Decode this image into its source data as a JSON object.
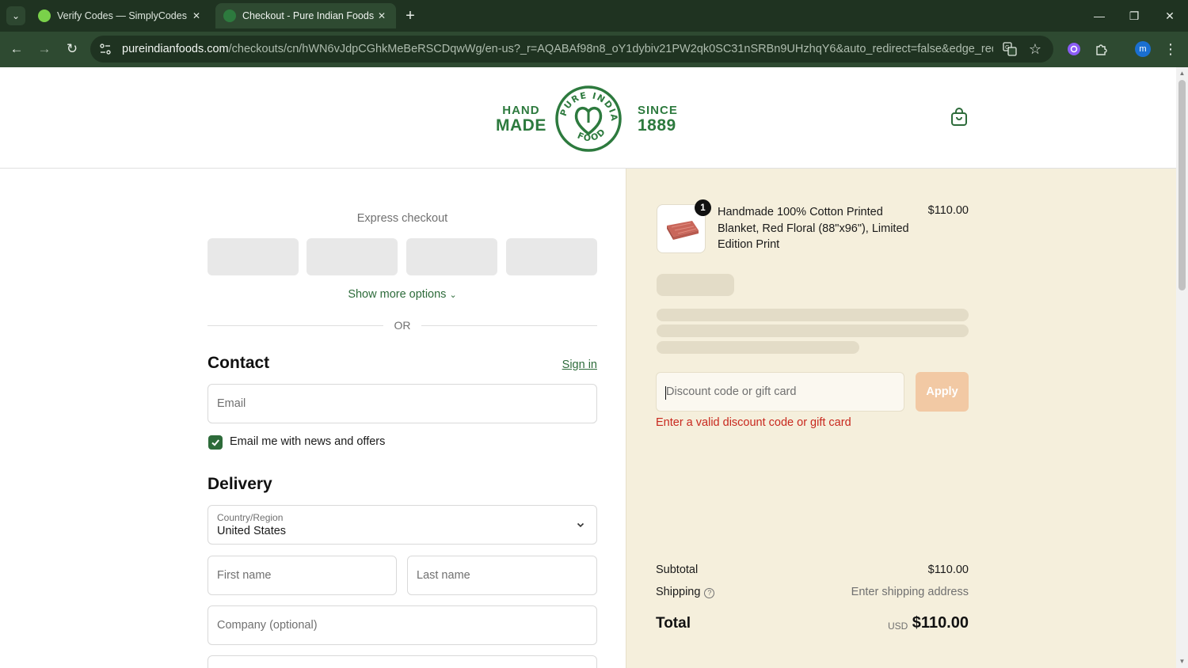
{
  "browser": {
    "tabs": [
      {
        "title": "Verify Codes — SimplyCodes",
        "active": false,
        "favicon_color": "#7ad14a"
      },
      {
        "title": "Checkout - Pure Indian Foods",
        "active": true,
        "favicon_color": "#2d7a3e"
      }
    ],
    "url_host": "pureindianfoods.com",
    "url_path": "/checkouts/cn/hWN6vJdpCGhkMeBeRSCDqwWg/en-us?_r=AQABAf98n8_oY1dybiv21PW2qk0SC31nSRBn9UHzhqY6&auto_redirect=false&edge_redirect=true&...",
    "profile_initial": "m",
    "icons": [
      "tab-search-icon",
      "back-icon",
      "forward-icon",
      "reload-icon",
      "site-settings-icon",
      "translate-icon",
      "star-icon",
      "extension-icon",
      "puzzle-icon",
      "menu-icon"
    ]
  },
  "header": {
    "logo_left": [
      "HAND",
      "MADE"
    ],
    "logo_center": "PURE INDIAN FOODS",
    "logo_right": [
      "SINCE",
      "1889"
    ],
    "brand_color": "#2d7a3e"
  },
  "checkout": {
    "express_title": "Express checkout",
    "show_more": "Show more options",
    "or_label": "OR",
    "contact_heading": "Contact",
    "sign_in": "Sign in",
    "email_placeholder": "Email",
    "news_checkbox_label": "Email me with news and offers",
    "news_checked": true,
    "delivery_heading": "Delivery",
    "country_label": "Country/Region",
    "country_value": "United States",
    "first_name_placeholder": "First name",
    "last_name_placeholder": "Last name",
    "company_placeholder": "Company (optional)",
    "accent_color": "#2d6b3a"
  },
  "summary": {
    "product_name": "Handmade 100% Cotton Printed Blanket, Red Floral (88\"x96\"), Limited Edition Print",
    "product_price": "$110.00",
    "quantity": "1",
    "discount_placeholder": "Discount code or gift card",
    "apply_label": "Apply",
    "discount_error": "Enter a valid discount code or gift card",
    "subtotal_label": "Subtotal",
    "subtotal_value": "$110.00",
    "shipping_label": "Shipping",
    "shipping_value": "Enter shipping address",
    "total_label": "Total",
    "total_currency": "USD",
    "total_value": "$110.00",
    "error_color": "#c8281e",
    "bg_color": "#f5efdc"
  }
}
